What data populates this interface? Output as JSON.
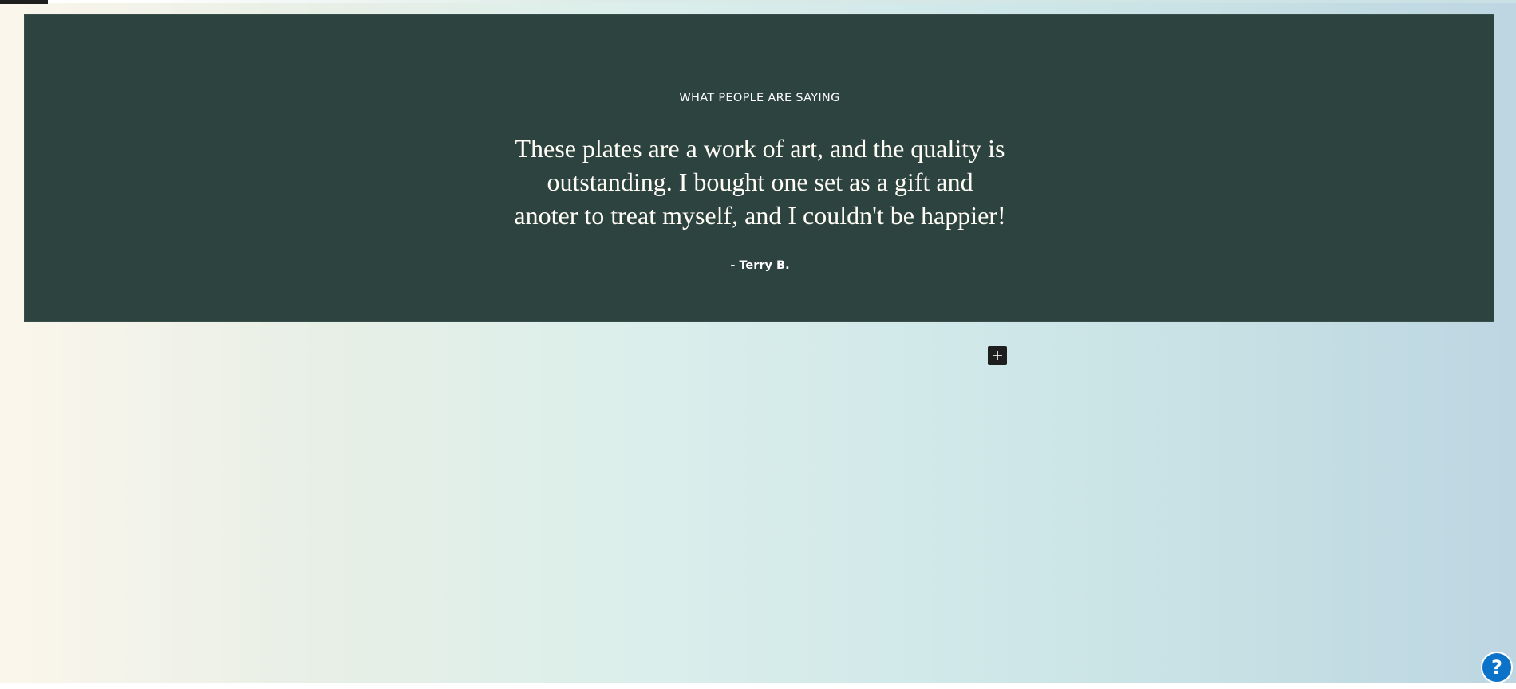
{
  "testimonial": {
    "eyebrow": "WHAT PEOPLE ARE SAYING",
    "quote": "These plates are a work of art, and the quality is outstanding. I bought one set as a gift and anoter to treat myself, and I couldn't be happier!",
    "author": "- Terry B.",
    "background_color": "#2d433f"
  },
  "editor": {
    "add_block_icon": "plus-icon",
    "help_icon": "help-icon",
    "help_label": "?",
    "accent_color": "#0b72c9"
  }
}
